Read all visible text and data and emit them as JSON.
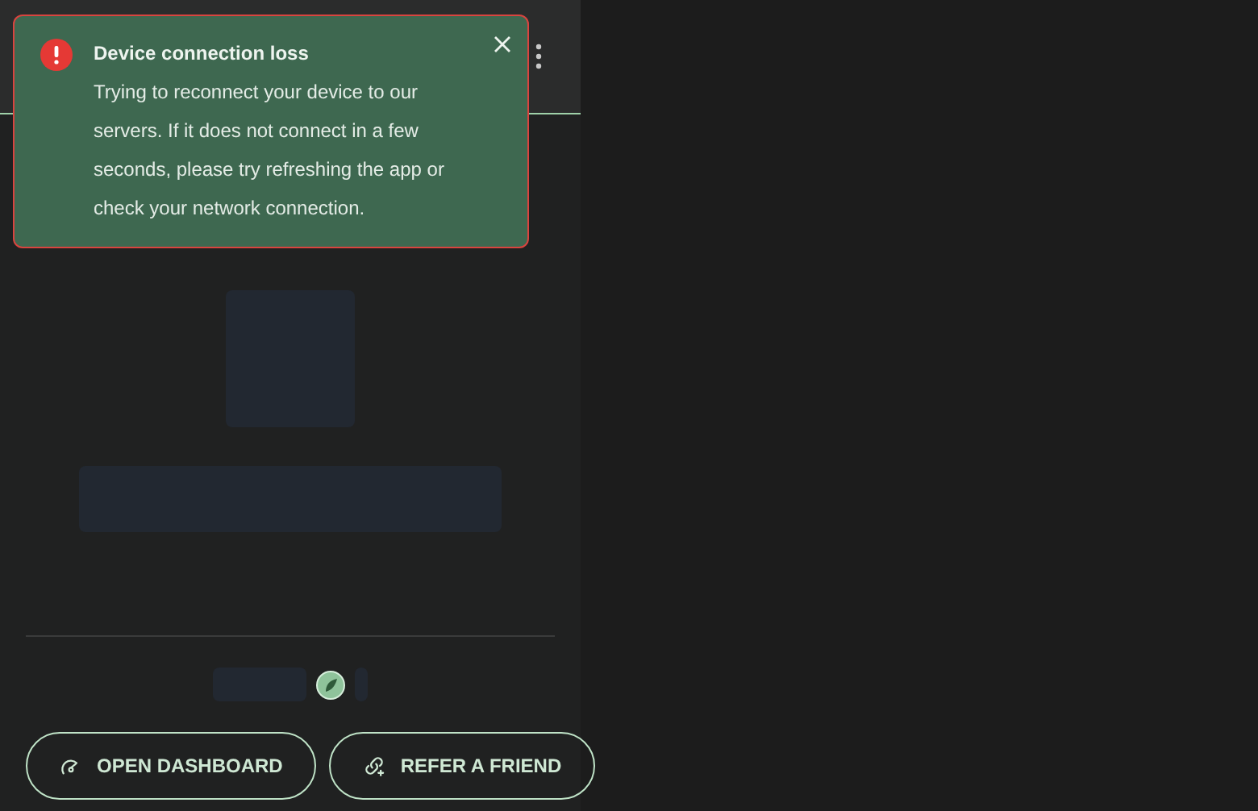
{
  "toast": {
    "title": "Device connection loss",
    "message": "Trying to reconnect your device to our servers. If it does not connect in a few seconds, please try refreshing the app or check your network connection."
  },
  "buttons": [
    {
      "kind": "dashboard",
      "label": "OPEN DASHBOARD"
    },
    {
      "kind": "refer",
      "label": "REFER A FRIEND"
    }
  ]
}
